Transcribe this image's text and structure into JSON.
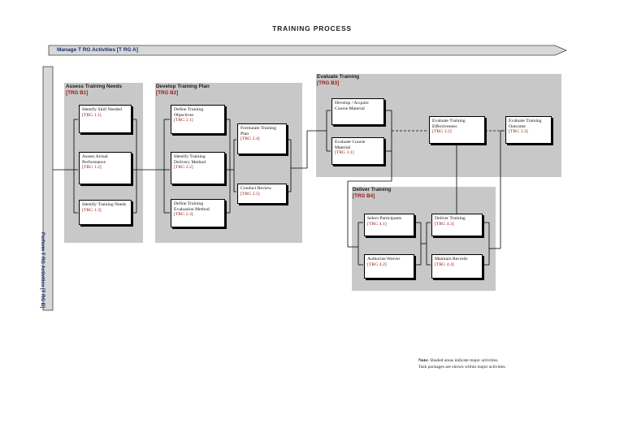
{
  "title": "TRAINING PROCESS",
  "manage_bar": "Manage T RG Activities [T RG A]",
  "perform_bar": "Perform T RG Activities [T RG B]",
  "activities": [
    {
      "title": "Assess Training Needs",
      "code": "[TRG B1]"
    },
    {
      "title": "Develop Training Plan",
      "code": "[TRG B2]"
    },
    {
      "title": "Evaluate Training",
      "code": "[TRG B3]"
    },
    {
      "title": "Deliver Training",
      "code": "[TRG B4]"
    }
  ],
  "tasks": {
    "t11": {
      "label": "Identify Skill Needed",
      "code": "[TRG 1.1]"
    },
    "t12": {
      "label": "Assess Actual Performance",
      "code": "[TRG 1.2]"
    },
    "t13": {
      "label": "Identify Training Needs",
      "code": "[TRG 1.3]"
    },
    "t21": {
      "label": "Define Training Objectives",
      "code": "[TRG 2.1]"
    },
    "t22": {
      "label": "Identify Training Delivery Method",
      "code": "[TRG 2.2]"
    },
    "t23": {
      "label": "Define Training Evaluation Method",
      "code": "[TRG 2.3]"
    },
    "t24": {
      "label": "Formulate Training Plan",
      "code": "[TRG 2.4]"
    },
    "t25": {
      "label": "Conduct Review",
      "code": "[TRG 2.5]"
    },
    "t31": {
      "label": "Develop / Acquire Course Material",
      "code": ""
    },
    "t31b": {
      "label": "Evaluate Course Material",
      "code": "[TRG 3.1]"
    },
    "t32": {
      "label": "Evaluate Training Effectiveness",
      "code": "[TRG 3.2]"
    },
    "t33": {
      "label": "Evaluate Training Outcome",
      "code": "[TRG 3.3]"
    },
    "t41": {
      "label": "Select Participants",
      "code": "[TRG 4.1]"
    },
    "t42": {
      "label": "Authorize Waiver",
      "code": "[TRG 4.2]"
    },
    "t43": {
      "label": "Deliver Training",
      "code": "[TRG 4.3]"
    },
    "t44": {
      "label": "Maintain Records",
      "code": "[TRG 4.4]"
    }
  },
  "note": {
    "bold": "Note:",
    "line1": "Shaded areas indicate major activities.",
    "line2": "Task packages are shown within major activities."
  },
  "colors": {
    "shade": "#c8c8c8",
    "code_red": "#a01818",
    "bar_text": "#1a2a6e"
  }
}
